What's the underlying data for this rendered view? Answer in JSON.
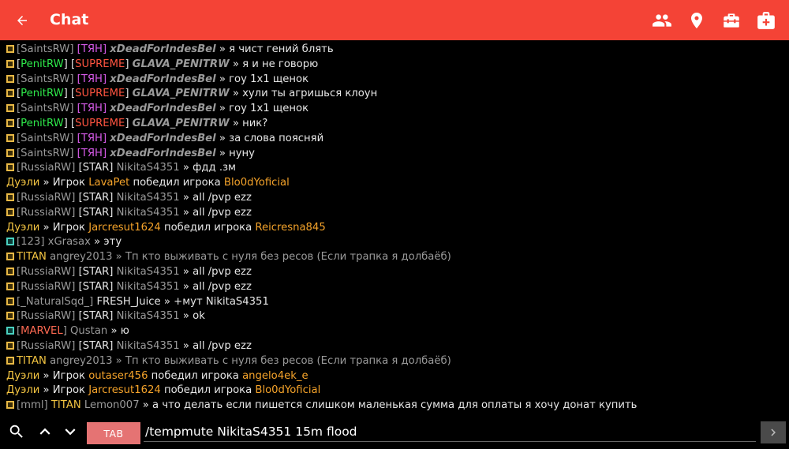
{
  "header": {
    "title": "Chat",
    "icons": [
      "arrow-back-icon",
      "people-icon",
      "location-pin-icon",
      "toolbox-icon",
      "first-aid-kit-icon"
    ]
  },
  "colors": {
    "app_bar": "#f44336",
    "background": "#000000",
    "tab_button": "#e57373",
    "green": "#2ee84a",
    "red": "#ff5440",
    "magenta": "#d65ae8",
    "yellow": "#f4c542",
    "orange": "#f5a32a"
  },
  "chat": {
    "lines": [
      {
        "kind": "chat",
        "icon": "yellow",
        "parts": [
          {
            "t": "[SaintsRW] ",
            "c": "g"
          },
          {
            "t": "[ТЯН] ",
            "c": "mag"
          },
          {
            "t": "xDeadForIndesBel",
            "c": "g bi"
          },
          {
            "t": " » я чист гений блять",
            "c": "w"
          }
        ]
      },
      {
        "kind": "chat",
        "icon": "yellow",
        "parts": [
          {
            "t": "[",
            "c": "w"
          },
          {
            "t": "PenitRW",
            "c": "grn"
          },
          {
            "t": "] ",
            "c": "w"
          },
          {
            "t": "[",
            "c": "w"
          },
          {
            "t": "SUPREME",
            "c": "red"
          },
          {
            "t": "] ",
            "c": "w"
          },
          {
            "t": "GLAVA_PENITRW",
            "c": "g bi"
          },
          {
            "t": " » я и не говорю",
            "c": "w"
          }
        ]
      },
      {
        "kind": "chat",
        "icon": "yellow",
        "parts": [
          {
            "t": "[SaintsRW] ",
            "c": "g"
          },
          {
            "t": "[ТЯН] ",
            "c": "mag"
          },
          {
            "t": "xDeadForIndesBel",
            "c": "g bi"
          },
          {
            "t": " » гоу 1х1 щенок",
            "c": "w"
          }
        ]
      },
      {
        "kind": "chat",
        "icon": "yellow",
        "parts": [
          {
            "t": "[",
            "c": "w"
          },
          {
            "t": "PenitRW",
            "c": "grn"
          },
          {
            "t": "] ",
            "c": "w"
          },
          {
            "t": "[",
            "c": "w"
          },
          {
            "t": "SUPREME",
            "c": "red"
          },
          {
            "t": "] ",
            "c": "w"
          },
          {
            "t": "GLAVA_PENITRW",
            "c": "g bi"
          },
          {
            "t": " » хули ты агришься клоун",
            "c": "w"
          }
        ]
      },
      {
        "kind": "chat",
        "icon": "yellow",
        "parts": [
          {
            "t": "[SaintsRW] ",
            "c": "g"
          },
          {
            "t": "[ТЯН] ",
            "c": "mag"
          },
          {
            "t": "xDeadForIndesBel",
            "c": "g bi"
          },
          {
            "t": " » гоу 1х1 щенок",
            "c": "w"
          }
        ]
      },
      {
        "kind": "chat",
        "icon": "yellow",
        "parts": [
          {
            "t": "[",
            "c": "w"
          },
          {
            "t": "PenitRW",
            "c": "grn"
          },
          {
            "t": "] ",
            "c": "w"
          },
          {
            "t": "[",
            "c": "w"
          },
          {
            "t": "SUPREME",
            "c": "red"
          },
          {
            "t": "] ",
            "c": "w"
          },
          {
            "t": "GLAVA_PENITRW",
            "c": "g bi"
          },
          {
            "t": " » ник?",
            "c": "w"
          }
        ]
      },
      {
        "kind": "chat",
        "icon": "yellow",
        "parts": [
          {
            "t": "[SaintsRW] ",
            "c": "g"
          },
          {
            "t": "[ТЯН] ",
            "c": "mag"
          },
          {
            "t": "xDeadForIndesBel",
            "c": "g bi"
          },
          {
            "t": " » за слова поясняй",
            "c": "w"
          }
        ]
      },
      {
        "kind": "chat",
        "icon": "yellow",
        "parts": [
          {
            "t": "[SaintsRW] ",
            "c": "g"
          },
          {
            "t": "[ТЯН] ",
            "c": "mag"
          },
          {
            "t": "xDeadForIndesBel",
            "c": "g bi"
          },
          {
            "t": " » нуну",
            "c": "w"
          }
        ]
      },
      {
        "kind": "chat",
        "icon": "yellow",
        "parts": [
          {
            "t": "[RussiaRW] ",
            "c": "g"
          },
          {
            "t": "[STAR] ",
            "c": "w"
          },
          {
            "t": "NikitaS4351",
            "c": "g"
          },
          {
            "t": " » фдд .зм",
            "c": "w"
          }
        ]
      },
      {
        "kind": "duel",
        "parts": [
          {
            "t": "Дуэли",
            "c": "yel"
          },
          {
            "t": " » Игрок ",
            "c": "w"
          },
          {
            "t": "LavaPet",
            "c": "org"
          },
          {
            "t": " победил игрока ",
            "c": "w"
          },
          {
            "t": "Blo0dYoficial",
            "c": "org"
          }
        ]
      },
      {
        "kind": "chat",
        "icon": "yellow",
        "parts": [
          {
            "t": "[RussiaRW] ",
            "c": "g"
          },
          {
            "t": "[STAR] ",
            "c": "w"
          },
          {
            "t": "NikitaS4351",
            "c": "g"
          },
          {
            "t": " » all /pvp ezz",
            "c": "w"
          }
        ]
      },
      {
        "kind": "chat",
        "icon": "yellow",
        "parts": [
          {
            "t": "[RussiaRW] ",
            "c": "g"
          },
          {
            "t": "[STAR] ",
            "c": "w"
          },
          {
            "t": "NikitaS4351",
            "c": "g"
          },
          {
            "t": " » all /pvp ezz",
            "c": "w"
          }
        ]
      },
      {
        "kind": "duel",
        "parts": [
          {
            "t": "Дуэли",
            "c": "yel"
          },
          {
            "t": " » Игрок ",
            "c": "w"
          },
          {
            "t": "Jarcresut1624",
            "c": "org"
          },
          {
            "t": " победил игрока ",
            "c": "w"
          },
          {
            "t": "Reicresna845",
            "c": "org"
          }
        ]
      },
      {
        "kind": "chat",
        "icon": "teal",
        "parts": [
          {
            "t": "[123] ",
            "c": "g"
          },
          {
            "t": "xGrasax",
            "c": "g"
          },
          {
            "t": " » эту",
            "c": "w"
          }
        ]
      },
      {
        "kind": "chat",
        "icon": "yellow",
        "parts": [
          {
            "t": "TITAN ",
            "c": "yel"
          },
          {
            "t": "angrey2013",
            "c": "g"
          },
          {
            "t": " » Тп кто выживать с нуля без ресов (Если трапка я долбаёб)",
            "c": "g"
          }
        ]
      },
      {
        "kind": "chat",
        "icon": "yellow",
        "parts": [
          {
            "t": "[RussiaRW] ",
            "c": "g"
          },
          {
            "t": "[STAR] ",
            "c": "w"
          },
          {
            "t": "NikitaS4351",
            "c": "g"
          },
          {
            "t": " » all /pvp ezz",
            "c": "w"
          }
        ]
      },
      {
        "kind": "chat",
        "icon": "yellow",
        "parts": [
          {
            "t": "[RussiaRW] ",
            "c": "g"
          },
          {
            "t": "[STAR] ",
            "c": "w"
          },
          {
            "t": "NikitaS4351",
            "c": "g"
          },
          {
            "t": " » all /pvp ezz",
            "c": "w"
          }
        ]
      },
      {
        "kind": "chat",
        "icon": "yellow",
        "parts": [
          {
            "t": "[_NaturalSqd_] ",
            "c": "g"
          },
          {
            "t": "FRESH_Juice",
            "c": "w"
          },
          {
            "t": " » +мут NikitaS4351",
            "c": "w"
          }
        ]
      },
      {
        "kind": "chat",
        "icon": "yellow",
        "parts": [
          {
            "t": "[RussiaRW] ",
            "c": "g"
          },
          {
            "t": "[STAR] ",
            "c": "w"
          },
          {
            "t": "NikitaS4351",
            "c": "g"
          },
          {
            "t": " » ok",
            "c": "w"
          }
        ]
      },
      {
        "kind": "chat",
        "icon": "teal",
        "parts": [
          {
            "t": "[",
            "c": "g"
          },
          {
            "t": "MARVEL",
            "c": "rb"
          },
          {
            "t": "] ",
            "c": "g"
          },
          {
            "t": "Qustan",
            "c": "g"
          },
          {
            "t": " » ю",
            "c": "w"
          }
        ]
      },
      {
        "kind": "chat",
        "icon": "yellow",
        "parts": [
          {
            "t": "[RussiaRW] ",
            "c": "g"
          },
          {
            "t": "[STAR] ",
            "c": "w"
          },
          {
            "t": "NikitaS4351",
            "c": "g"
          },
          {
            "t": " » all /pvp ezz",
            "c": "w"
          }
        ]
      },
      {
        "kind": "chat",
        "icon": "yellow",
        "parts": [
          {
            "t": "TITAN ",
            "c": "yel"
          },
          {
            "t": "angrey2013",
            "c": "g"
          },
          {
            "t": " » Тп кто выживать с нуля без ресов (Если трапка я долбаёб)",
            "c": "g"
          }
        ]
      },
      {
        "kind": "duel",
        "parts": [
          {
            "t": "Дуэли",
            "c": "yel"
          },
          {
            "t": " » Игрок ",
            "c": "w"
          },
          {
            "t": "outaser456",
            "c": "org"
          },
          {
            "t": " победил игрока ",
            "c": "w"
          },
          {
            "t": "angelo4ek_e",
            "c": "org"
          }
        ]
      },
      {
        "kind": "duel",
        "parts": [
          {
            "t": "Дуэли",
            "c": "yel"
          },
          {
            "t": " » Игрок ",
            "c": "w"
          },
          {
            "t": "Jarcresut1624",
            "c": "org"
          },
          {
            "t": " победил игрока ",
            "c": "w"
          },
          {
            "t": "Blo0dYoficial",
            "c": "org"
          }
        ]
      },
      {
        "kind": "chat",
        "icon": "yellow",
        "parts": [
          {
            "t": "[mml] ",
            "c": "g"
          },
          {
            "t": "TITAN ",
            "c": "yel"
          },
          {
            "t": "Lemon007",
            "c": "g"
          },
          {
            "t": " » а что делать если пишется слишком маленькая сумма для оплаты я хочу донат купить",
            "c": "w"
          }
        ]
      }
    ]
  },
  "bottom": {
    "tab_label": "TAB",
    "input_value": "/tempmute NikitaS4351 15m flood",
    "icons": [
      "search-icon",
      "chevron-up-icon",
      "chevron-down-icon",
      "send-arrow-icon"
    ]
  }
}
